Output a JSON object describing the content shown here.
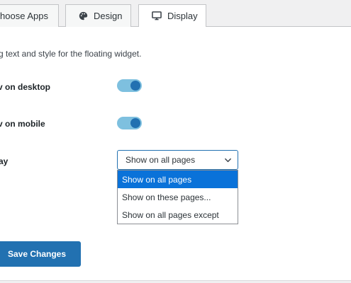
{
  "tabs": [
    {
      "label": "hoose Apps",
      "icon": "none"
    },
    {
      "label": "Design",
      "icon": "palette-icon"
    },
    {
      "label": "Display",
      "icon": "monitor-icon",
      "active": true
    }
  ],
  "panel": {
    "description": "g text and style for the floating widget."
  },
  "settings": {
    "desktop_label": "v on desktop",
    "desktop_enabled": true,
    "mobile_label": "v on mobile",
    "mobile_enabled": true,
    "display_label": "ay"
  },
  "display_select": {
    "value": "Show on all pages",
    "options": [
      "Show on all pages",
      "Show on these pages...",
      "Show on all pages except"
    ],
    "selected_index": 0
  },
  "save_button": {
    "label": "Save Changes"
  },
  "colors": {
    "accent": "#2271b1",
    "toggle_track": "#7ec0df",
    "option_highlight": "#0a72d9",
    "background": "#f0f0f1"
  }
}
